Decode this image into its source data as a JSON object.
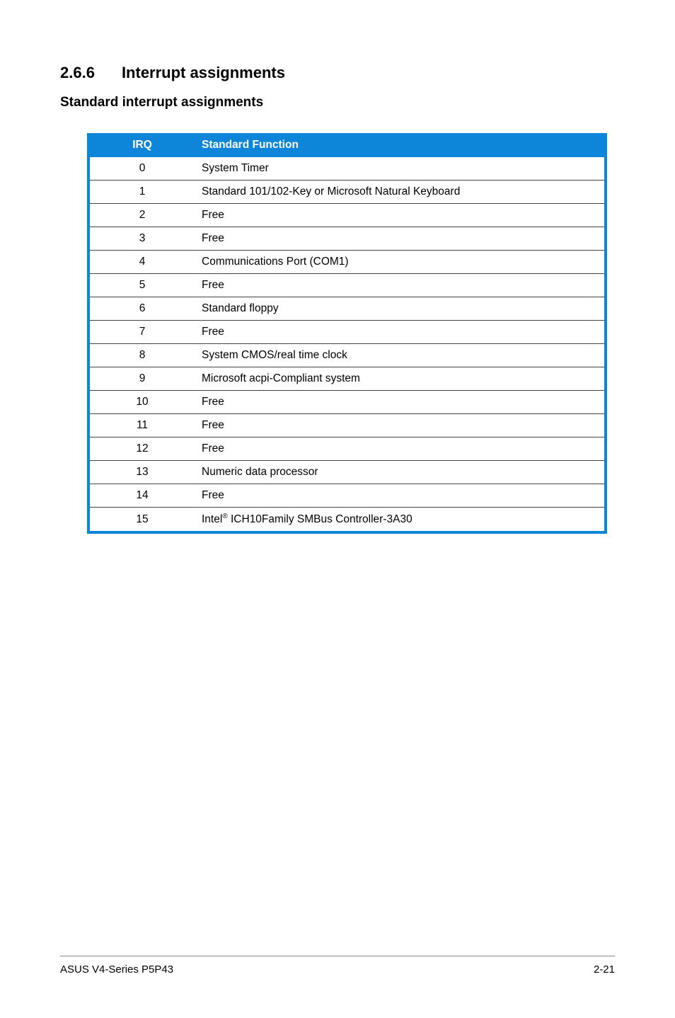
{
  "heading": {
    "number": "2.6.6",
    "title": "Interrupt assignments"
  },
  "subheading": "Standard interrupt assignments",
  "table": {
    "headers": {
      "irq": "IRQ",
      "func": "Standard Function"
    },
    "rows": [
      {
        "irq": "0",
        "func": "System Timer"
      },
      {
        "irq": "1",
        "func": "Standard 101/102-Key or Microsoft Natural Keyboard"
      },
      {
        "irq": "2",
        "func": "Free"
      },
      {
        "irq": "3",
        "func": "Free"
      },
      {
        "irq": "4",
        "func": "Communications Port (COM1)"
      },
      {
        "irq": "5",
        "func": "Free"
      },
      {
        "irq": "6",
        "func": "Standard floppy"
      },
      {
        "irq": "7",
        "func": "Free"
      },
      {
        "irq": "8",
        "func": "System CMOS/real time clock"
      },
      {
        "irq": "9",
        "func": "Microsoft acpi-Compliant system"
      },
      {
        "irq": "10",
        "func": "Free"
      },
      {
        "irq": "11",
        "func": "Free"
      },
      {
        "irq": "12",
        "func": "Free"
      },
      {
        "irq": "13",
        "func": "Numeric data processor"
      },
      {
        "irq": "14",
        "func": "Free"
      },
      {
        "irq": "15",
        "func_prefix": "Intel",
        "func_reg": "®",
        "func_suffix": " ICH10Family SMBus Controller-3A30"
      }
    ]
  },
  "footer": {
    "left": "ASUS V4-Series P5P43",
    "right": "2-21"
  }
}
